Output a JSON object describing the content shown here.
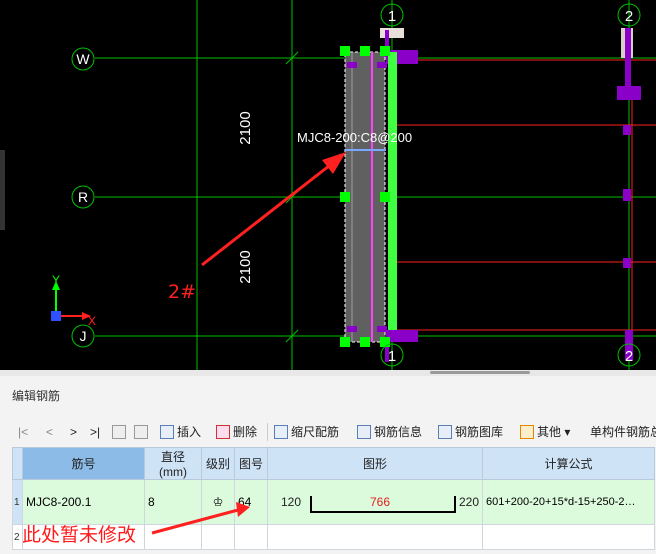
{
  "drawing": {
    "axis_left": [
      "W",
      "R",
      "J"
    ],
    "axis_top": [
      "1",
      "2"
    ],
    "axis_bottom": [
      "1",
      "2"
    ],
    "dims": [
      "2100",
      "2100"
    ],
    "element_label": "MJC8-200:C8@200",
    "callout": "2#",
    "ucs": {
      "x": "X",
      "y": "Y"
    },
    "colors": {
      "background": "#000000",
      "grid": "#00c000",
      "red_line": "#ff2020",
      "purple": "#8a00c8",
      "member": "#606060",
      "rebar": "#ff40ff",
      "handle": "#00ff00",
      "bar": "#40ff40"
    }
  },
  "panel": {
    "title": "编辑钢筋",
    "toolbar": {
      "nav_first": "|<",
      "nav_prev": "<",
      "nav_next": ">",
      "nav_last": ">|",
      "insert": "插入",
      "delete": "删除",
      "scale": "缩尺配筋",
      "info": "钢筋信息",
      "library": "钢筋图库",
      "other": "其他",
      "single": "单构件钢筋总"
    },
    "table": {
      "headers": [
        "筋号",
        "直径(mm)",
        "级别",
        "图号",
        "图形",
        "计算公式"
      ],
      "rows": [
        {
          "index": "1",
          "bar_no": "MJC8-200.1",
          "diameter": "8",
          "grade": "♔",
          "shape_no": "64",
          "shape": {
            "left": "120",
            "middle": "766",
            "right": "220"
          },
          "formula": "601+200-20+15*d-15+250-2…"
        },
        {
          "index": "2",
          "bar_no": "",
          "diameter": "",
          "grade": "",
          "shape_no": "",
          "shape": {
            "left": "",
            "middle": "",
            "right": ""
          },
          "formula": ""
        }
      ]
    },
    "annotation": "此处暂未修改"
  }
}
